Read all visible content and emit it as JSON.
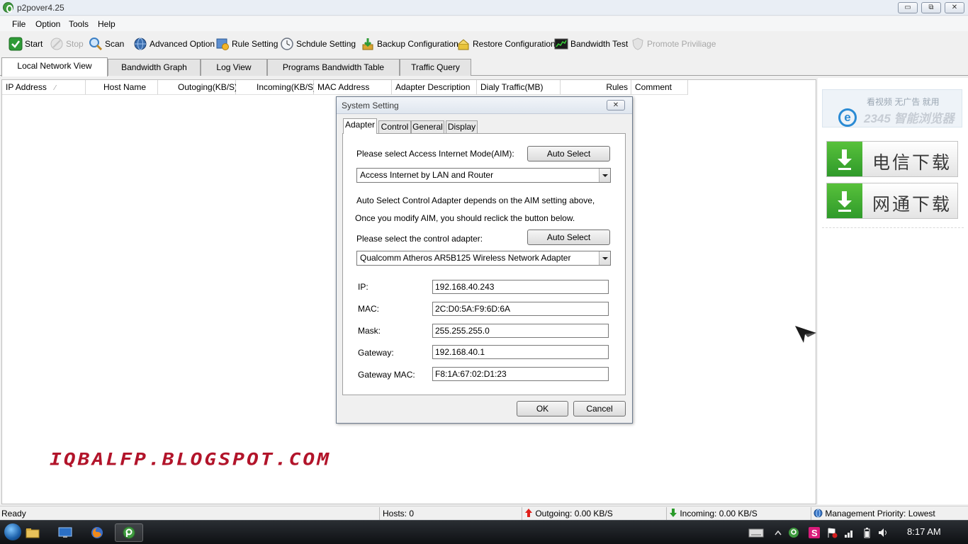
{
  "window": {
    "title": "p2pover4.25",
    "buttons": [
      "▭",
      "⧉",
      "✕"
    ]
  },
  "menu": [
    "File",
    "Option",
    "Tools",
    "Help"
  ],
  "toolbar": {
    "start": "Start",
    "stop": "Stop",
    "scan": "Scan",
    "advanced": "Advanced Option",
    "rule": "Rule Setting",
    "schedule": "Schdule Setting",
    "backup": "Backup Configuration",
    "restore": "Restore Configuration",
    "bandwidth_test": "Bandwidth Test",
    "promote": "Promote Priviliage"
  },
  "tabs": [
    "Local Network View",
    "Bandwidth Graph",
    "Log View",
    "Programs Bandwidth Table",
    "Traffic Query"
  ],
  "columns": [
    "IP Address",
    "Host Name",
    "Outoging(KB/S)",
    "Incoming(KB/S)",
    "MAC Address",
    "Adapter Description",
    "Dialy Traffic(MB)",
    "Rules",
    "Comment"
  ],
  "sort_marker": "⁄",
  "ads": {
    "browser_line1": "看视频 无广告 就用",
    "browser_line2": "2345 智能浏览器",
    "download1": "电信下载",
    "download2": "网通下载"
  },
  "watermark": "IQBALFP.BLOGSPOT.COM",
  "dialog": {
    "title": "System Setting",
    "close": "✕",
    "tabs": [
      "Adapter",
      "Control",
      "General",
      "Display"
    ],
    "aim_label": "Please select Access Internet Mode(AIM):",
    "auto_select": "Auto Select",
    "aim_value": "Access Internet by LAN and Router",
    "note1": "Auto Select Control Adapter depends on the AIM setting above,",
    "note2": "Once you modify AIM, you should reclick the button below.",
    "adapter_label": "Please select the control adapter:",
    "adapter_value": "Qualcomm Atheros AR5B125 Wireless Network Adapter",
    "fields": {
      "ip_label": "IP:",
      "ip": "192.168.40.243",
      "mac_label": "MAC:",
      "mac": "2C:D0:5A:F9:6D:6A",
      "mask_label": "Mask:",
      "mask": "255.255.255.0",
      "gateway_label": "Gateway:",
      "gateway": "192.168.40.1",
      "gwmac_label": "Gateway MAC:",
      "gwmac": "F8:1A:67:02:D1:23"
    },
    "ok": "OK",
    "cancel": "Cancel"
  },
  "status": {
    "ready": "Ready",
    "hosts": "Hosts: 0",
    "outgoing": "Outgoing: 0.00 KB/S",
    "incoming": "Incoming: 0.00 KB/S",
    "priority": "Management Priority: Lowest"
  },
  "taskbar": {
    "clock": "8:17 AM"
  },
  "colors": {
    "accent": "#3f9b3f",
    "watermark": "#b2142a",
    "download_green": "#2f9a2a"
  }
}
